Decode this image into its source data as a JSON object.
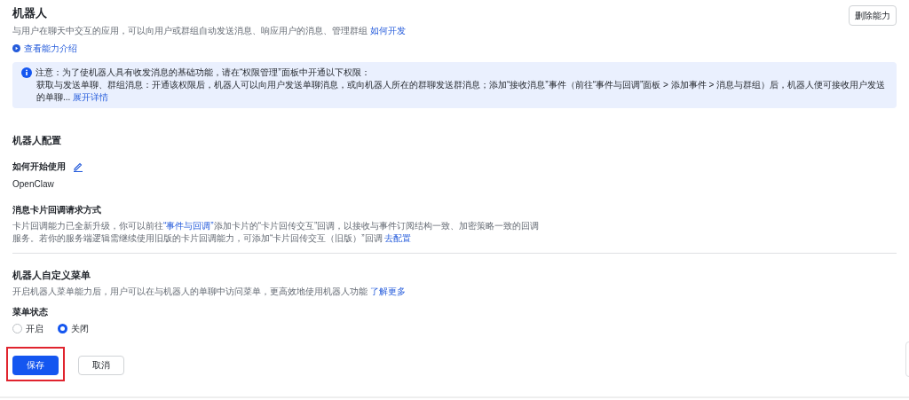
{
  "header": {
    "title": "机器人",
    "description": "与用户在聊天中交互的应用，可以向用户或群组自动发送消息、响应用户的消息、管理群组",
    "description_link": "如何开发",
    "intro_link": "查看能力介绍",
    "delete_button": "删除能力"
  },
  "notice": {
    "title": "注意：为了使机器人具有收发消息的基础功能，请在“权限管理”面板中开通以下权限：",
    "detail": "获取与发送单聊、群组消息：开通该权限后，机器人可以向用户发送单聊消息，或向机器人所在的群聊发送群消息；添加“接收消息”事件（前往“事件与回调”面板 > 添加事件 > 消息与群组）后，机器人便可接收用户发送的单聊...",
    "expand_link": "展开详情"
  },
  "config": {
    "title": "机器人配置",
    "usage_label": "如何开始使用",
    "usage_value": "OpenClaw",
    "callback_label": "消息卡片回调请求方式",
    "callback_text_before": "卡片回调能力已全新升级，你可以前往",
    "callback_link": "“事件与回调”",
    "callback_text_after": "添加卡片的“卡片回传交互”回调，以接收与事件订阅结构一致、加密策略一致的回调服务。若你的服务端逻辑需继续使用旧版的卡片回调能力，可添加“卡片回传交互（旧版）”回调",
    "callback_config_link": "去配置"
  },
  "menu": {
    "title": "机器人自定义菜单",
    "description": "开启机器人菜单能力后，用户可以在与机器人的单聊中访问菜单，更高效地使用机器人功能",
    "description_link": "了解更多",
    "status_label": "菜单状态",
    "options": [
      {
        "label": "开启",
        "selected": false
      },
      {
        "label": "关闭",
        "selected": true
      }
    ]
  },
  "buttons": [
    {
      "label": "保存",
      "kind": "primary",
      "highlighted": true
    },
    {
      "label": "取消",
      "kind": "secondary",
      "highlighted": false
    }
  ]
}
